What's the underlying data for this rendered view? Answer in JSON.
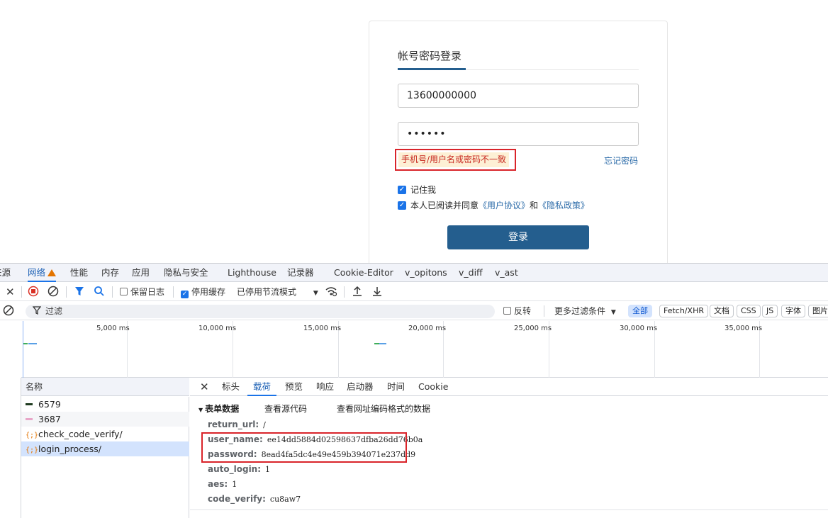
{
  "login": {
    "tab_title": "帐号密码登录",
    "phone_value": "13600000000",
    "password_value": "••••••",
    "error_message": "手机号/用户名或密码不一致",
    "forgot_link": "忘记密码",
    "remember_me": "记住我",
    "agree_prefix": "本人已阅读并同意",
    "agree_user_protocol": "《用户协议》",
    "agree_and": "和",
    "agree_privacy": "《隐私政策》",
    "submit": "登录",
    "accent_color": "#245e8e",
    "error_color": "#d9242a"
  },
  "devtools": {
    "tabs": [
      "来源",
      "网络",
      "性能",
      "内存",
      "应用",
      "隐私与安全",
      "Lighthouse",
      "记录器",
      "Cookie-Editor",
      "v_opitons",
      "v_diff",
      "v_ast"
    ],
    "active_tab": "网络",
    "toolbar": {
      "preserve_log": "保留日志",
      "disable_cache": "停用缓存",
      "throttle": "已停用节流模式"
    },
    "filter": {
      "placeholder": "过滤",
      "invert": "反转",
      "more_filters": "更多过滤条件",
      "types": [
        "全部",
        "Fetch/XHR",
        "文档",
        "CSS",
        "JS",
        "字体",
        "图片"
      ]
    },
    "timeline": {
      "ticks": [
        "5,000 ms",
        "10,000 ms",
        "15,000 ms",
        "20,000 ms",
        "25,000 ms",
        "30,000 ms",
        "35,000 ms"
      ]
    },
    "requests": {
      "header": "名称",
      "items": [
        {
          "name": "6579",
          "icon": "green-dash-icon"
        },
        {
          "name": "3687",
          "icon": "pink-dash-icon"
        },
        {
          "name": "check_code_verify/",
          "icon": "xhr-icon"
        },
        {
          "name": "login_process/",
          "icon": "xhr-icon"
        }
      ]
    },
    "detail": {
      "tabs": [
        "标头",
        "载荷",
        "预览",
        "响应",
        "启动器",
        "时间",
        "Cookie"
      ],
      "active_tab": "载荷",
      "section_title": "表单数据",
      "view_source": "查看源代码",
      "view_url_encoded": "查看网址编码格式的数据",
      "form_data": [
        {
          "key": "return_url:",
          "value": "/"
        },
        {
          "key": "user_name:",
          "value": "ee14dd5884d02598637dfba26dd76b0a"
        },
        {
          "key": "password:",
          "value": "8ead4fa5dc4e49e459b394071e237dd9"
        },
        {
          "key": "auto_login:",
          "value": "1"
        },
        {
          "key": "aes:",
          "value": "1"
        },
        {
          "key": "code_verify:",
          "value": "cu8aw7"
        }
      ]
    }
  }
}
